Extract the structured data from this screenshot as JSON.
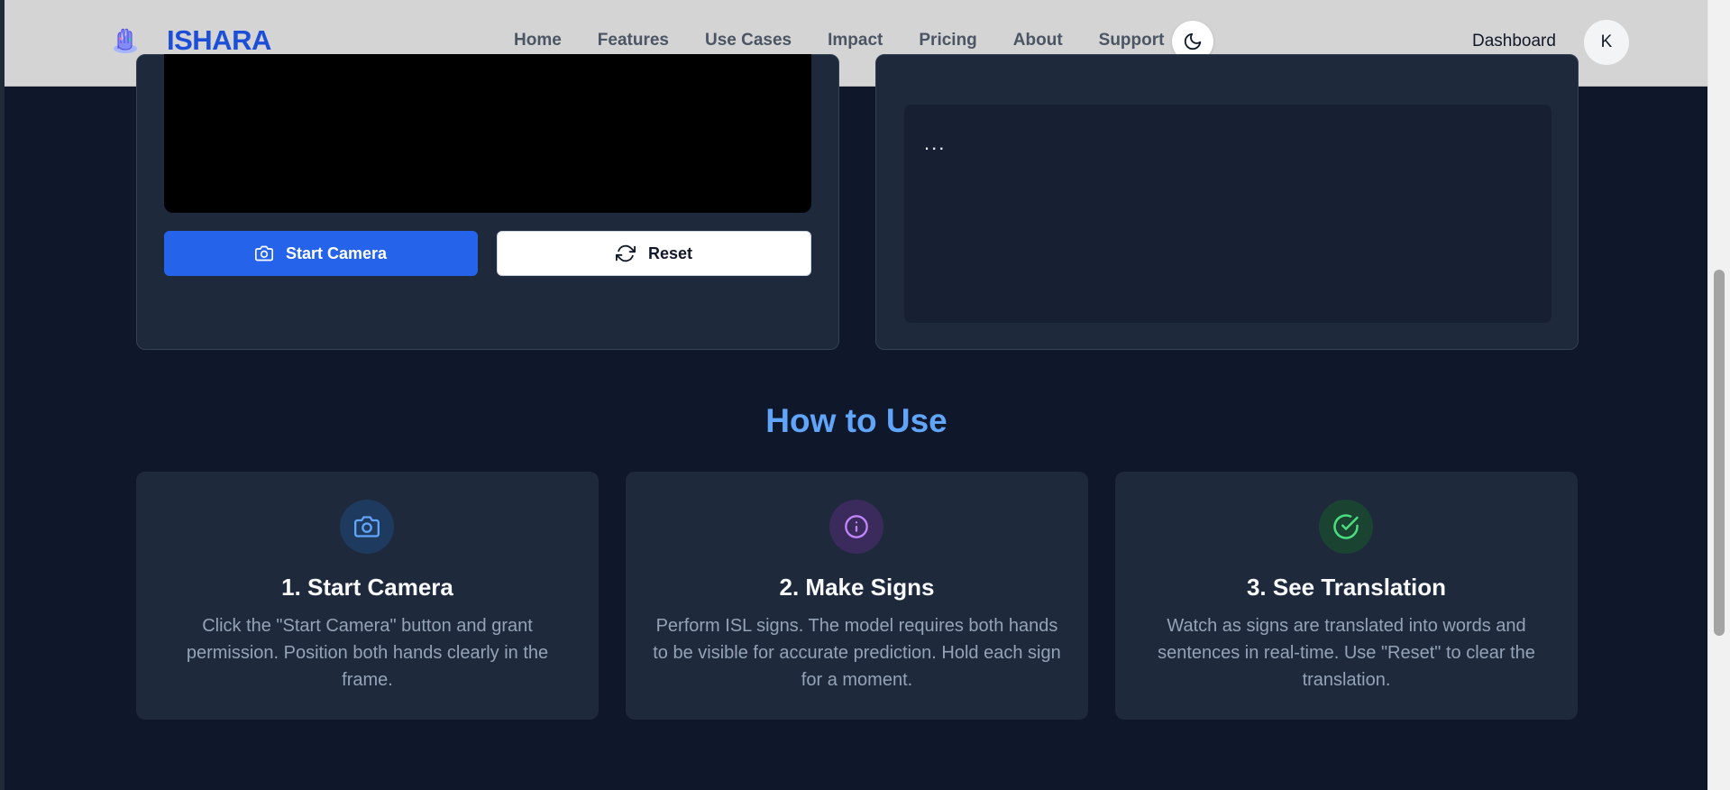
{
  "brand": {
    "name": "ISHARA"
  },
  "nav": {
    "links": [
      "Home",
      "Features",
      "Use Cases",
      "Impact",
      "Pricing",
      "About",
      "Support"
    ],
    "dashboard": "Dashboard",
    "avatar_initial": "K"
  },
  "camera": {
    "start_label": "Start Camera",
    "reset_label": "Reset"
  },
  "output": {
    "text": "..."
  },
  "how_to_use": {
    "title": "How to Use",
    "steps": [
      {
        "title": "1. Start Camera",
        "description": "Click the \"Start Camera\" button and grant permission. Position both hands clearly in the frame.",
        "icon": "camera-icon",
        "color": "#60a5fa"
      },
      {
        "title": "2. Make Signs",
        "description": "Perform ISL signs. The model requires both hands to be visible for accurate prediction. Hold each sign for a moment.",
        "icon": "info-icon",
        "color": "#c084fc"
      },
      {
        "title": "3. See Translation",
        "description": "Watch as signs are translated into words and sentences in real-time. Use \"Reset\" to clear the translation.",
        "icon": "check-circle-icon",
        "color": "#4ade80"
      }
    ]
  },
  "colors": {
    "accent": "#2563eb",
    "brand": "#1d4ed8",
    "heading": "#60a5fa",
    "background": "#0f172a"
  }
}
